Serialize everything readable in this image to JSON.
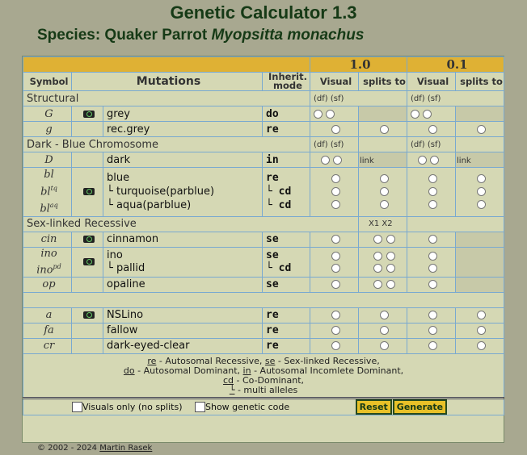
{
  "title": "Genetic Calculator 1.3",
  "species_prefix": "Species: Quaker Parrot",
  "species_latin": "Myopsitta monachus",
  "parents": {
    "male": "1.0",
    "female": "0.1"
  },
  "headers": {
    "symbol": "Symbol",
    "mutations": "Mutations",
    "inherit": "Inherit. mode",
    "visual": "Visual",
    "splits": "splits to"
  },
  "dfsf": "(df)  (sf)",
  "link_label": "link",
  "sections": {
    "structural": "Structural",
    "dark_blue": "Dark - Blue Chromosome",
    "sex_linked": "Sex-linked Recessive",
    "x1x2": "X1  X2"
  },
  "rows": {
    "grey": {
      "sym": "G",
      "name": "grey",
      "mode": "do"
    },
    "recgrey": {
      "sym": "g",
      "name": "rec.grey",
      "mode": "re"
    },
    "dark": {
      "sym": "D",
      "name": "dark",
      "mode": "in"
    },
    "blue": {
      "sym": "bl",
      "name": "blue",
      "mode": "re"
    },
    "turq": {
      "sym": "bl",
      "sup": "tq",
      "name": "turquoise(parblue)",
      "mode": "cd"
    },
    "aqua": {
      "sym": "bl",
      "sup": "aq",
      "name": "aqua(parblue)",
      "mode": "cd"
    },
    "cin": {
      "sym": "cin",
      "name": "cinnamon",
      "mode": "se"
    },
    "ino": {
      "sym": "ino",
      "name": "ino",
      "mode": "se"
    },
    "pallid": {
      "sym": "ino",
      "sup": "pd",
      "name": "pallid",
      "mode": "cd"
    },
    "op": {
      "sym": "op",
      "name": "opaline",
      "mode": "se"
    },
    "a": {
      "sym": "a",
      "name": "NSLino",
      "mode": "re"
    },
    "fa": {
      "sym": "fa",
      "name": "fallow",
      "mode": "re"
    },
    "cr": {
      "sym": "cr",
      "name": "dark-eyed-clear",
      "mode": "re"
    }
  },
  "allele_marker": "└",
  "legend": {
    "l1a": "re",
    "l1b": " - Autosomal Recessive, ",
    "l1c": "se",
    "l1d": " - Sex-linked Recessive,",
    "l2a": "do",
    "l2b": " - Autosomal Dominant, ",
    "l2c": "in",
    "l2d": " - Autosomal Incomlete Dominant,",
    "l3a": "cd",
    "l3b": " - Co-Dominant,",
    "l4a": "└",
    "l4b": " - multi alleles"
  },
  "controls": {
    "visuals_only": "Visuals only (no splits)",
    "show_code": "Show genetic code",
    "reset": "Reset",
    "generate": "Generate"
  },
  "footer": {
    "copy": "© 2002 - 2024 ",
    "author": "Martin Rasek"
  }
}
